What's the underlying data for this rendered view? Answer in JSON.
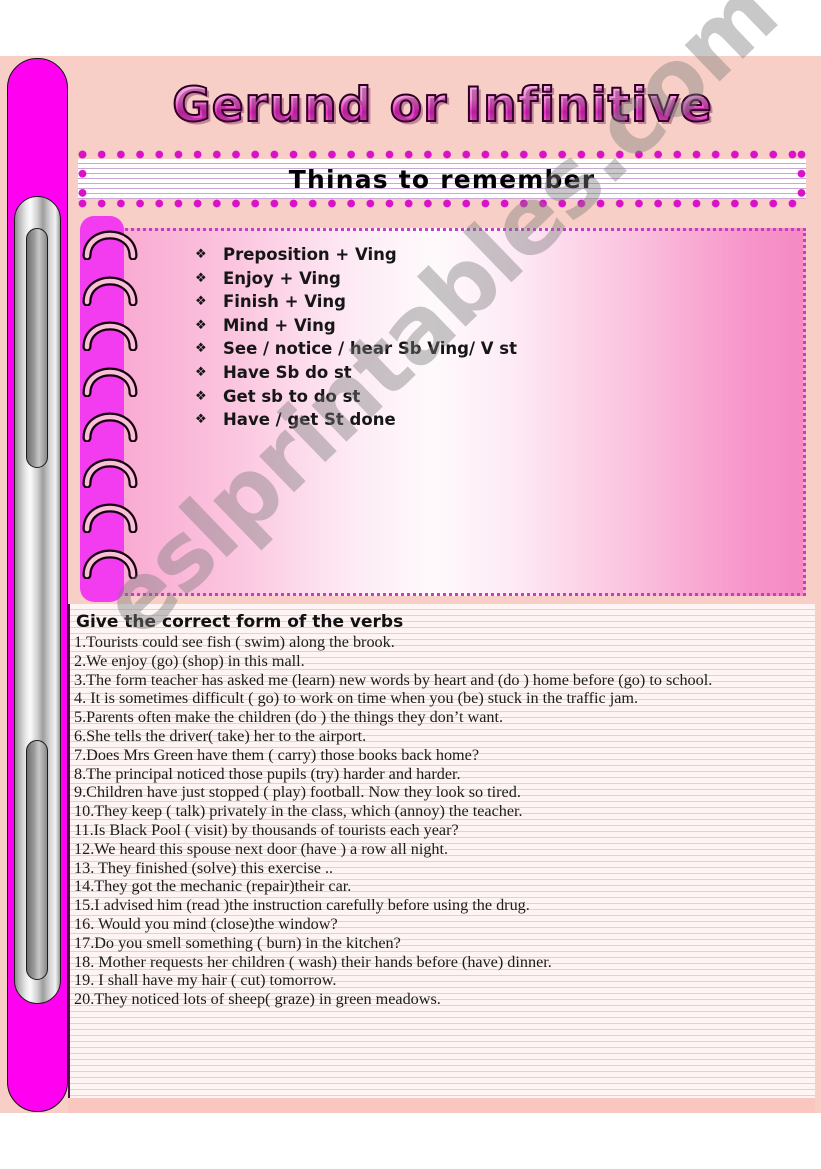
{
  "page": {
    "title": "Gerund or Infinitive",
    "subtitle": "Thinas to remember",
    "watermark": "eslprintables.com"
  },
  "colors": {
    "page_background": "#f8cfc6",
    "binder_magenta": "#ff00f0",
    "dot_border_magenta": "#d912c8",
    "notes_border_purple": "#c23ec2",
    "spiral_strip": "#f33bf0",
    "title_pink": "#e830c6",
    "rule_line": "#f6c9c3",
    "text_dark": "#161616"
  },
  "notes": {
    "bullet_glyph": "❖",
    "items": [
      "Preposition + Ving",
      "Enjoy + Ving",
      "Finish + Ving",
      "Mind + Ving",
      "See / notice / hear Sb Ving/ V st",
      "Have Sb do st",
      " Get sb to do st",
      "Have / get St done"
    ]
  },
  "exercise": {
    "heading": "Give the correct form of the verbs",
    "items": [
      "1.Tourists could see fish ( swim) along the brook.",
      "2.We enjoy (go) (shop) in this mall.",
      "3.The form teacher has asked me (learn) new words by heart and  (do ) home before (go) to school.",
      "4. It  is sometimes difficult ( go)  to work on time  when you (be) stuck in the traffic jam.",
      "5.Parents often make  the children (do )  the things they don’t want.",
      "6.She tells the driver( take) her to the airport.",
      "7.Does Mrs Green have them ( carry) those books back home?",
      "8.The principal noticed those pupils (try) harder and harder.",
      "9.Children have just stopped ( play) football. Now they look so tired.",
      "10.They keep ( talk) privately in the class, which (annoy) the teacher.",
      "11.Is Black Pool ( visit) by thousands of tourists each year?",
      "12.We heard this spouse next door (have ) a row all night.",
      "13. They finished (solve) this exercise ..",
      "14.They got the mechanic (repair)their car.",
      "15.I advised him (read )the instruction carefully before using the drug.",
      "16. Would you mind (close)the window?",
      "17.Do you smell something ( burn) in the kitchen?",
      "18. Mother requests her children ( wash) their hands before (have) dinner.",
      "19. I shall have  my hair ( cut) tomorrow.",
      "20.They noticed lots of sheep( graze) in green meadows."
    ]
  },
  "binder": {
    "ring_count": 8
  }
}
